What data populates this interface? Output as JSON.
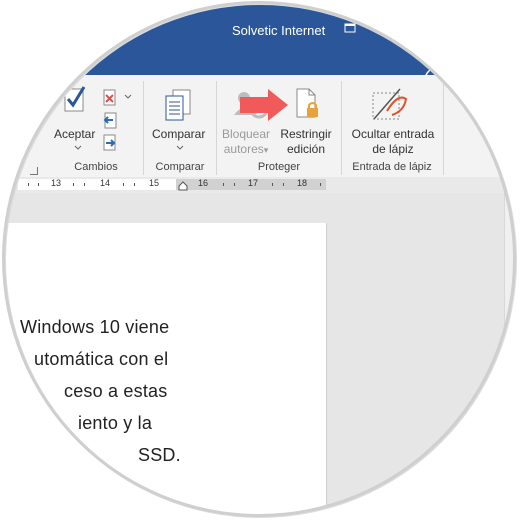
{
  "window": {
    "title": "Solvetic Internet"
  },
  "ribbon": {
    "buttons": {
      "aceptar": "Aceptar",
      "comparar": "Comparar",
      "bloquear_line1": "Bloquear",
      "bloquear_line2": "autores",
      "restringir_line1": "Restringir",
      "restringir_line2": "edición",
      "ocultar_line1": "Ocultar entrada",
      "ocultar_line2": "de lápiz"
    },
    "groups": {
      "cambios": "Cambios",
      "comparar": "Comparar",
      "proteger": "Proteger",
      "entrada_lapiz": "Entrada de lápiz"
    }
  },
  "ruler": {
    "numbers": [
      "13",
      "14",
      "15",
      "16",
      "17",
      "18"
    ]
  },
  "document": {
    "lines": [
      "Windows 10 viene",
      "utomática con el",
      "ceso a estas",
      "iento y la",
      "SSD."
    ]
  },
  "colors": {
    "titlebar": "#2b579a",
    "arrow": "#f05a5a",
    "lock": "#e8a23a"
  }
}
